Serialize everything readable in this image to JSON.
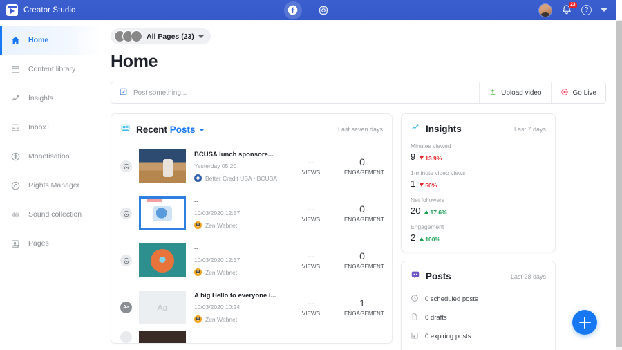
{
  "topbar": {
    "brand": "Creator Studio",
    "platform_tabs": [
      {
        "name": "facebook-tab",
        "active": true
      },
      {
        "name": "instagram-tab",
        "active": false
      }
    ],
    "notification_count": "23",
    "help_label": "?"
  },
  "sidebar": {
    "items": [
      {
        "label": "Home",
        "icon": "home-icon",
        "active": true
      },
      {
        "label": "Content library",
        "icon": "library-icon",
        "active": false
      },
      {
        "label": "Insights",
        "icon": "insights-chart-icon",
        "active": false
      },
      {
        "label": "Inbox+",
        "icon": "inbox-icon",
        "active": false
      },
      {
        "label": "Monetisation",
        "icon": "dollar-circle-icon",
        "active": false
      },
      {
        "label": "Rights Manager",
        "icon": "copyright-icon",
        "active": false
      },
      {
        "label": "Sound collection",
        "icon": "sound-wave-icon",
        "active": false
      },
      {
        "label": "Pages",
        "icon": "pages-icon",
        "active": false
      }
    ]
  },
  "header": {
    "page_selector": "All Pages (23)",
    "title": "Home"
  },
  "composer": {
    "placeholder": "Post something...",
    "upload_video": "Upload video",
    "go_live": "Go Live"
  },
  "recent_posts": {
    "title_static": "Recent",
    "title_dropdown": "Posts",
    "range": "Last seven days",
    "stat_labels": {
      "views": "VIEWS",
      "engagement": "ENGAGEMENT"
    },
    "rows": [
      {
        "type_icon": "photo-icon",
        "thumb": "photo",
        "title": "BCUSA lunch sponsore...",
        "time": "Yesterday 05:20",
        "page": "Better Credit USA - BCUSA",
        "page_av": "bcusa",
        "views": "--",
        "engagement": "0"
      },
      {
        "type_icon": "photo-icon",
        "thumb": "blue-graphic",
        "title": "--",
        "time": "10/03/2020 12:57",
        "page": "Zen Webnet",
        "page_av": "zen",
        "views": "--",
        "engagement": "0"
      },
      {
        "type_icon": "photo-icon",
        "thumb": "teal-graphic",
        "title": "--",
        "time": "10/03/2020 12:57",
        "page": "Zen Webnet",
        "page_av": "zen",
        "views": "--",
        "engagement": "0"
      },
      {
        "type_icon": "text-post-icon",
        "thumb": "aa",
        "thumb_label": "Aa",
        "title": "A big Hello to everyone i...",
        "time": "10/03/2020 10:24",
        "page": "Zen Webnet",
        "page_av": "zen",
        "views": "--",
        "engagement": "1"
      }
    ]
  },
  "insights": {
    "title": "Insights",
    "range": "Last 7 days",
    "metrics": [
      {
        "label": "Minutes viewed",
        "value": "9",
        "delta": "13.9%",
        "direction": "down"
      },
      {
        "label": "1-minute video views",
        "value": "1",
        "delta": "50%",
        "direction": "down"
      },
      {
        "label": "Net followers",
        "value": "20",
        "delta": "17.6%",
        "direction": "up"
      },
      {
        "label": "Engagement",
        "value": "2",
        "delta": "100%",
        "direction": "up"
      }
    ]
  },
  "posts_panel": {
    "title": "Posts",
    "range": "Last 28 days",
    "items": [
      {
        "label": "0 scheduled posts",
        "icon": "clock-icon"
      },
      {
        "label": "0 drafts",
        "icon": "document-icon"
      },
      {
        "label": "0 expiring posts",
        "icon": "calendar-icon"
      }
    ]
  },
  "fab": {
    "label": "+"
  },
  "colors": {
    "brand_blue": "#1877f2",
    "topbar_blue": "#3b5bdb",
    "up_green": "#1a9e52",
    "down_red": "#e4252a",
    "posts_purple": "#6a55c2"
  }
}
